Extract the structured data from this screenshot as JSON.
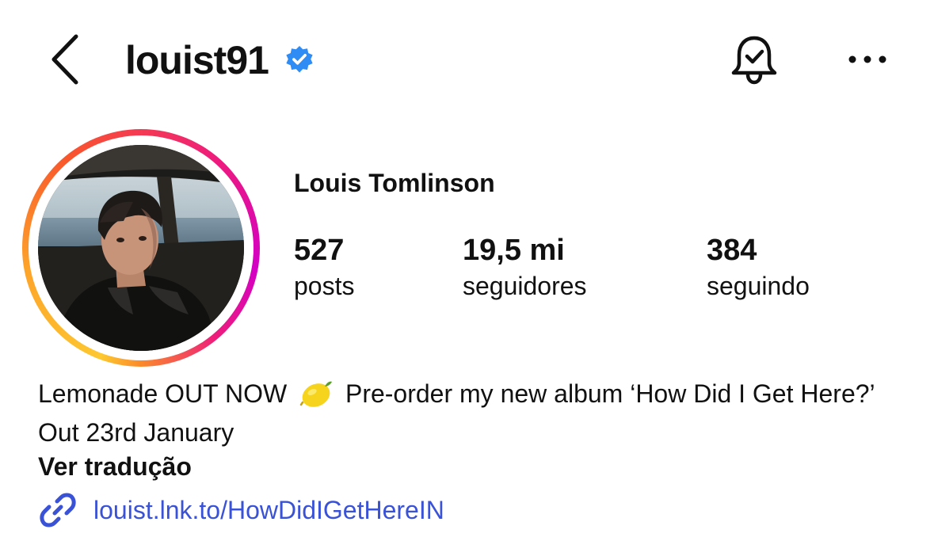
{
  "header": {
    "username": "louist91",
    "verified": true
  },
  "profile": {
    "display_name": "Louis Tomlinson",
    "stats": [
      {
        "value": "527",
        "label": "posts"
      },
      {
        "value": "19,5 mi",
        "label": "seguidores"
      },
      {
        "value": "384",
        "label": "seguindo"
      }
    ]
  },
  "bio": {
    "line_before_emoji": "Lemonade OUT NOW",
    "emoji": "lemon-icon",
    "line_after_emoji": "Pre-order my new album ‘How Did I Get Here?’ Out 23rd January",
    "translate_label": "Ver tradução",
    "link": "louist.lnk.to/HowDidIGetHereIN"
  },
  "colors": {
    "verified_blue": "#2f8cf5",
    "link_blue": "#3a52d6"
  }
}
